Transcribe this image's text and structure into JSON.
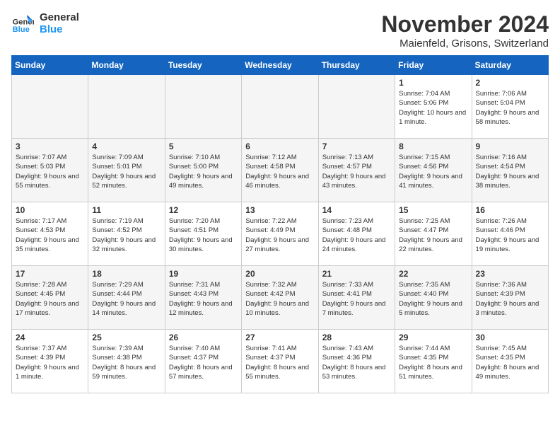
{
  "header": {
    "logo_line1": "General",
    "logo_line2": "Blue",
    "month_title": "November 2024",
    "location": "Maienfeld, Grisons, Switzerland"
  },
  "weekdays": [
    "Sunday",
    "Monday",
    "Tuesday",
    "Wednesday",
    "Thursday",
    "Friday",
    "Saturday"
  ],
  "weeks": [
    [
      {
        "day": "",
        "info": ""
      },
      {
        "day": "",
        "info": ""
      },
      {
        "day": "",
        "info": ""
      },
      {
        "day": "",
        "info": ""
      },
      {
        "day": "",
        "info": ""
      },
      {
        "day": "1",
        "info": "Sunrise: 7:04 AM\nSunset: 5:06 PM\nDaylight: 10 hours and 1 minute."
      },
      {
        "day": "2",
        "info": "Sunrise: 7:06 AM\nSunset: 5:04 PM\nDaylight: 9 hours and 58 minutes."
      }
    ],
    [
      {
        "day": "3",
        "info": "Sunrise: 7:07 AM\nSunset: 5:03 PM\nDaylight: 9 hours and 55 minutes."
      },
      {
        "day": "4",
        "info": "Sunrise: 7:09 AM\nSunset: 5:01 PM\nDaylight: 9 hours and 52 minutes."
      },
      {
        "day": "5",
        "info": "Sunrise: 7:10 AM\nSunset: 5:00 PM\nDaylight: 9 hours and 49 minutes."
      },
      {
        "day": "6",
        "info": "Sunrise: 7:12 AM\nSunset: 4:58 PM\nDaylight: 9 hours and 46 minutes."
      },
      {
        "day": "7",
        "info": "Sunrise: 7:13 AM\nSunset: 4:57 PM\nDaylight: 9 hours and 43 minutes."
      },
      {
        "day": "8",
        "info": "Sunrise: 7:15 AM\nSunset: 4:56 PM\nDaylight: 9 hours and 41 minutes."
      },
      {
        "day": "9",
        "info": "Sunrise: 7:16 AM\nSunset: 4:54 PM\nDaylight: 9 hours and 38 minutes."
      }
    ],
    [
      {
        "day": "10",
        "info": "Sunrise: 7:17 AM\nSunset: 4:53 PM\nDaylight: 9 hours and 35 minutes."
      },
      {
        "day": "11",
        "info": "Sunrise: 7:19 AM\nSunset: 4:52 PM\nDaylight: 9 hours and 32 minutes."
      },
      {
        "day": "12",
        "info": "Sunrise: 7:20 AM\nSunset: 4:51 PM\nDaylight: 9 hours and 30 minutes."
      },
      {
        "day": "13",
        "info": "Sunrise: 7:22 AM\nSunset: 4:49 PM\nDaylight: 9 hours and 27 minutes."
      },
      {
        "day": "14",
        "info": "Sunrise: 7:23 AM\nSunset: 4:48 PM\nDaylight: 9 hours and 24 minutes."
      },
      {
        "day": "15",
        "info": "Sunrise: 7:25 AM\nSunset: 4:47 PM\nDaylight: 9 hours and 22 minutes."
      },
      {
        "day": "16",
        "info": "Sunrise: 7:26 AM\nSunset: 4:46 PM\nDaylight: 9 hours and 19 minutes."
      }
    ],
    [
      {
        "day": "17",
        "info": "Sunrise: 7:28 AM\nSunset: 4:45 PM\nDaylight: 9 hours and 17 minutes."
      },
      {
        "day": "18",
        "info": "Sunrise: 7:29 AM\nSunset: 4:44 PM\nDaylight: 9 hours and 14 minutes."
      },
      {
        "day": "19",
        "info": "Sunrise: 7:31 AM\nSunset: 4:43 PM\nDaylight: 9 hours and 12 minutes."
      },
      {
        "day": "20",
        "info": "Sunrise: 7:32 AM\nSunset: 4:42 PM\nDaylight: 9 hours and 10 minutes."
      },
      {
        "day": "21",
        "info": "Sunrise: 7:33 AM\nSunset: 4:41 PM\nDaylight: 9 hours and 7 minutes."
      },
      {
        "day": "22",
        "info": "Sunrise: 7:35 AM\nSunset: 4:40 PM\nDaylight: 9 hours and 5 minutes."
      },
      {
        "day": "23",
        "info": "Sunrise: 7:36 AM\nSunset: 4:39 PM\nDaylight: 9 hours and 3 minutes."
      }
    ],
    [
      {
        "day": "24",
        "info": "Sunrise: 7:37 AM\nSunset: 4:39 PM\nDaylight: 9 hours and 1 minute."
      },
      {
        "day": "25",
        "info": "Sunrise: 7:39 AM\nSunset: 4:38 PM\nDaylight: 8 hours and 59 minutes."
      },
      {
        "day": "26",
        "info": "Sunrise: 7:40 AM\nSunset: 4:37 PM\nDaylight: 8 hours and 57 minutes."
      },
      {
        "day": "27",
        "info": "Sunrise: 7:41 AM\nSunset: 4:37 PM\nDaylight: 8 hours and 55 minutes."
      },
      {
        "day": "28",
        "info": "Sunrise: 7:43 AM\nSunset: 4:36 PM\nDaylight: 8 hours and 53 minutes."
      },
      {
        "day": "29",
        "info": "Sunrise: 7:44 AM\nSunset: 4:35 PM\nDaylight: 8 hours and 51 minutes."
      },
      {
        "day": "30",
        "info": "Sunrise: 7:45 AM\nSunset: 4:35 PM\nDaylight: 8 hours and 49 minutes."
      }
    ]
  ]
}
